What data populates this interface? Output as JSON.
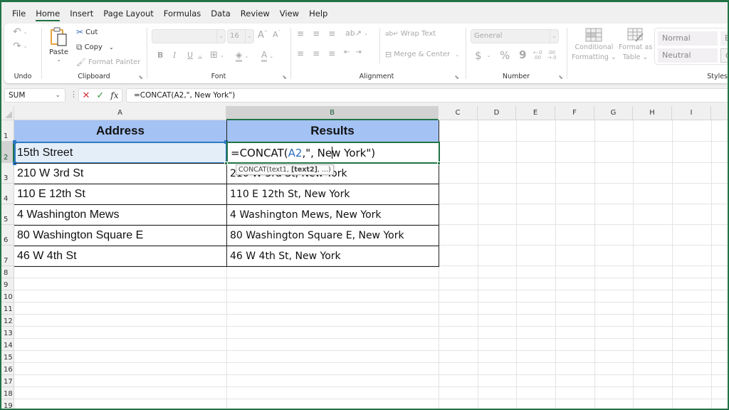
{
  "menu": {
    "tabs": [
      "File",
      "Home",
      "Insert",
      "Page Layout",
      "Formulas",
      "Data",
      "Review",
      "View",
      "Help"
    ],
    "active": "Home"
  },
  "ribbon": {
    "undo": {
      "label": "Undo"
    },
    "clipboard": {
      "label": "Clipboard",
      "paste": "Paste",
      "cut": "Cut",
      "copy": "Copy",
      "format_painter": "Format Painter"
    },
    "font": {
      "label": "Font",
      "font_name": "",
      "font_size": "16",
      "bold": "B",
      "italic": "I",
      "underline": "U"
    },
    "alignment": {
      "label": "Alignment",
      "wrap_text": "Wrap Text",
      "merge_center": "Merge & Center"
    },
    "number": {
      "label": "Number",
      "format": "General",
      "currency": "$",
      "percent": "%",
      "comma": "9"
    },
    "styles": {
      "label": "Styles",
      "conditional_formatting": [
        "Conditional",
        "Formatting"
      ],
      "format_as_table": [
        "Format as",
        "Table"
      ],
      "cells": [
        "Normal",
        "Bad",
        "Neutral",
        "Calculation"
      ]
    }
  },
  "formula_bar": {
    "name_box": "SUM",
    "formula": "=CONCAT(A2,\", New York\")"
  },
  "grid": {
    "columns": [
      "A",
      "B",
      "C",
      "D",
      "E",
      "F",
      "G",
      "H",
      "I"
    ],
    "rows": [
      "1",
      "2",
      "3",
      "4",
      "5",
      "6",
      "7",
      "8",
      "9",
      "10",
      "11",
      "12",
      "13",
      "14",
      "15",
      "16",
      "17",
      "18",
      "19"
    ],
    "selected_column": "B",
    "selected_row": "2"
  },
  "table": {
    "headers": [
      "Address",
      "Results"
    ],
    "addresses": [
      "15th Street",
      "210 W 3rd St",
      "110 E 12th St",
      "4 Washington Mews",
      "80 Washington Square E",
      "46 W 4th St"
    ],
    "results": [
      "",
      "210 W 3rd St, New York",
      "110 E 12th St, New York",
      "4 Washington Mews, New York",
      "80 Washington Square E, New York",
      "46 W 4th St, New York"
    ],
    "editing": {
      "prefix": "=CONCAT(",
      "ref": "A2",
      "middle": ",\", Ne",
      "suffix": "w York\")"
    },
    "tooltip": {
      "fn": "CONCAT(text1, ",
      "bold_arg": "[text2]",
      "rest": ", ...)"
    }
  }
}
